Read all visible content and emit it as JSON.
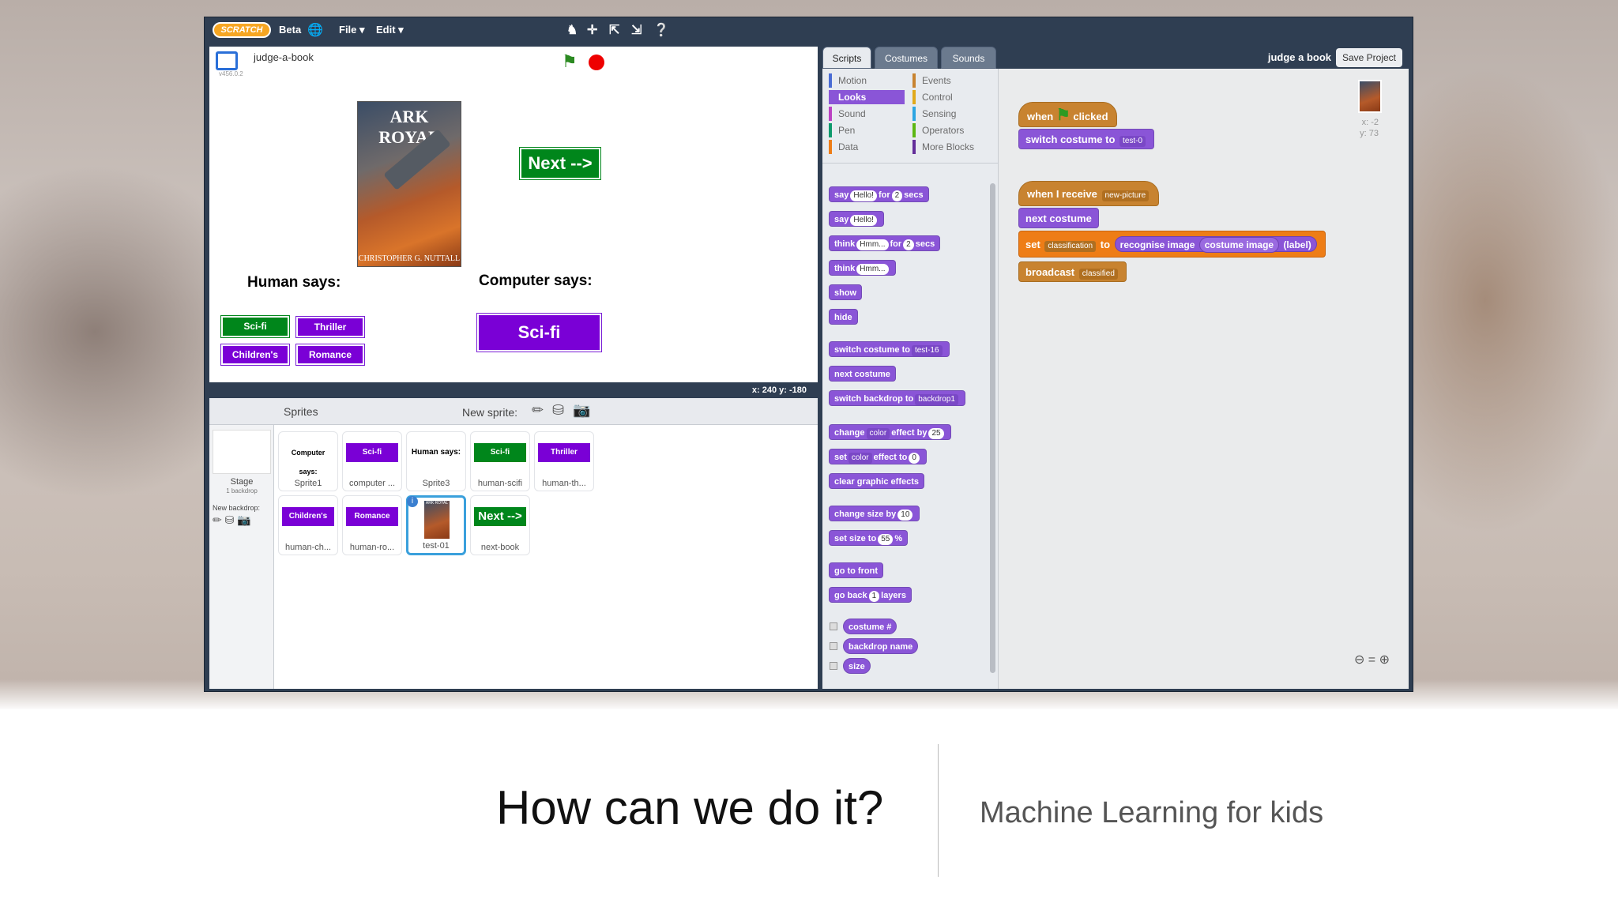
{
  "menubar": {
    "logo": "SCRATCH",
    "beta": "Beta",
    "file": "File ▾",
    "edit": "Edit ▾"
  },
  "stage": {
    "project_name": "judge-a-book",
    "version": "v456.0.2",
    "coords": "x: 240   y: -180",
    "book_title": "ARK ROYAL",
    "book_author": "CHRISTOPHER G. NUTTALL",
    "next_button": "Next -->",
    "human_says": "Human says:",
    "computer_says": "Computer says:",
    "human_buttons": [
      "Sci-fi",
      "Thriller",
      "Children's",
      "Romance"
    ],
    "computer_result": "Sci-fi"
  },
  "sprites": {
    "header": "Sprites",
    "new_sprite": "New sprite:",
    "stage_label": "Stage",
    "stage_sub": "1 backdrop",
    "new_backdrop": "New backdrop:",
    "tiles": [
      {
        "text": "Computer says:",
        "name": "Sprite1"
      },
      {
        "text": "Sci-fi",
        "name": "computer ..."
      },
      {
        "text": "Human says:",
        "name": "Sprite3"
      },
      {
        "text": "Sci-fi",
        "name": "human-scifi"
      },
      {
        "text": "Thriller",
        "name": "human-th..."
      },
      {
        "text": "Children's",
        "name": "human-ch..."
      },
      {
        "text": "Romance",
        "name": "human-ro..."
      },
      {
        "text": "ARK ROYAL",
        "name": "test-01"
      },
      {
        "text": "Next -->",
        "name": "next-book"
      }
    ]
  },
  "tabs": [
    "Scripts",
    "Costumes",
    "Sounds"
  ],
  "categories": [
    "Motion",
    "Looks",
    "Sound",
    "Pen",
    "Data",
    "Events",
    "Control",
    "Sensing",
    "Operators",
    "More Blocks"
  ],
  "palette": {
    "say_secs": [
      "say",
      "Hello!",
      "for",
      "2",
      "secs"
    ],
    "say": [
      "say",
      "Hello!"
    ],
    "think_secs": [
      "think",
      "Hmm...",
      "for",
      "2",
      "secs"
    ],
    "think": [
      "think",
      "Hmm..."
    ],
    "show": "show",
    "hide": "hide",
    "switch_costume": [
      "switch costume to",
      "test-16"
    ],
    "next_costume": "next costume",
    "switch_backdrop": [
      "switch backdrop to",
      "backdrop1"
    ],
    "change_effect": [
      "change",
      "color",
      "effect by",
      "25"
    ],
    "set_effect": [
      "set",
      "color",
      "effect to",
      "0"
    ],
    "clear_effects": "clear graphic effects",
    "change_size": [
      "change size by",
      "10"
    ],
    "set_size": [
      "set size to",
      "55",
      "%"
    ],
    "go_front": "go to front",
    "go_back": [
      "go back",
      "1",
      "layers"
    ],
    "reporters": [
      "costume #",
      "backdrop name",
      "size"
    ]
  },
  "project_title": "judge a book",
  "save_project": "Save Project",
  "sprite_info": {
    "x": "x: -2",
    "y": "y: 73"
  },
  "scripts": {
    "s1_hat": [
      "when",
      "clicked"
    ],
    "s1_b1": [
      "switch costume to",
      "test-0"
    ],
    "s2_hat": [
      "when I receive",
      "new-picture"
    ],
    "s2_b1": "next costume",
    "s2_b2": [
      "set",
      "classification",
      "to",
      "recognise image",
      "costume image",
      "(label)"
    ],
    "s2_b3": [
      "broadcast",
      "classified"
    ]
  },
  "caption": {
    "title": "How can we do it?",
    "subtitle": "Machine Learning for kids"
  }
}
